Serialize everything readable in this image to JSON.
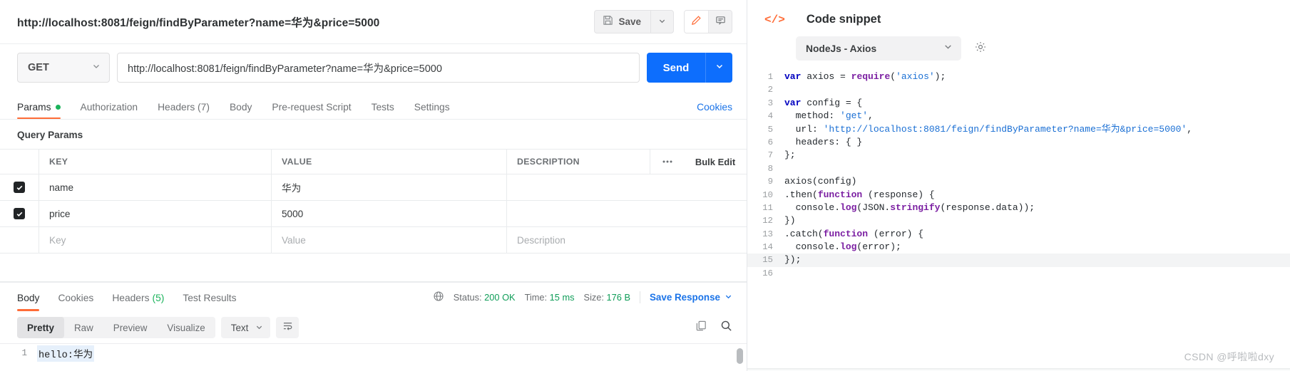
{
  "request": {
    "title": "http://localhost:8081/feign/findByParameter?name=华为&price=5000",
    "save_label": "Save",
    "save_icon": "floppy-disk-icon",
    "save_caret_icon": "chevron-down-icon",
    "edit_icon": "pencil-icon",
    "comment_icon": "comment-icon",
    "method": "GET",
    "method_caret_icon": "chevron-down-icon",
    "url": "http://localhost:8081/feign/findByParameter?name=华为&price=5000",
    "send_label": "Send",
    "send_caret_icon": "chevron-down-icon"
  },
  "request_tabs": [
    {
      "label": "Params",
      "dot": true,
      "active": true
    },
    {
      "label": "Authorization",
      "active": false
    },
    {
      "label": "Headers (7)",
      "active": false
    },
    {
      "label": "Body",
      "active": false
    },
    {
      "label": "Pre-request Script",
      "active": false
    },
    {
      "label": "Tests",
      "active": false
    },
    {
      "label": "Settings",
      "active": false
    }
  ],
  "cookies_link": "Cookies",
  "params": {
    "section_title": "Query Params",
    "columns": {
      "key": "KEY",
      "value": "VALUE",
      "description": "DESCRIPTION"
    },
    "more_icon": "ellipsis-icon",
    "bulk_edit": "Bulk Edit",
    "rows": [
      {
        "checked": true,
        "key": "name",
        "value": "华为",
        "description": ""
      },
      {
        "checked": true,
        "key": "price",
        "value": "5000",
        "description": ""
      }
    ],
    "placeholder_row": {
      "key": "Key",
      "value": "Value",
      "description": "Description"
    }
  },
  "response_tabs": [
    {
      "label": "Body",
      "active": true
    },
    {
      "label": "Cookies",
      "active": false
    },
    {
      "label": "Headers",
      "count": "(5)",
      "active": false
    },
    {
      "label": "Test Results",
      "active": false
    }
  ],
  "response_meta": {
    "globe_icon": "globe-icon",
    "status_label": "Status:",
    "status_value": "200 OK",
    "time_label": "Time:",
    "time_value": "15 ms",
    "size_label": "Size:",
    "size_value": "176 B",
    "save_response": "Save Response",
    "save_response_caret_icon": "chevron-down-icon"
  },
  "viewer": {
    "modes": [
      {
        "label": "Pretty",
        "active": true
      },
      {
        "label": "Raw",
        "active": false
      },
      {
        "label": "Preview",
        "active": false
      },
      {
        "label": "Visualize",
        "active": false
      }
    ],
    "format": "Text",
    "format_caret_icon": "chevron-down-icon",
    "wrap_icon": "wrap-lines-icon",
    "copy_icon": "copy-icon",
    "search_icon": "search-icon",
    "body_line_number": "1",
    "body_text": "hello:华为"
  },
  "code_snippet": {
    "panel_icon": "code-tags-icon",
    "title": "Code snippet",
    "language": "NodeJs - Axios",
    "language_caret_icon": "chevron-down-icon",
    "settings_icon": "gear-icon",
    "lines": [
      {
        "n": "1",
        "tokens": [
          {
            "t": "var ",
            "c": "k-kw"
          },
          {
            "t": "axios = ",
            "c": "k-pl"
          },
          {
            "t": "require",
            "c": "k-fn"
          },
          {
            "t": "(",
            "c": "k-pl"
          },
          {
            "t": "'axios'",
            "c": "k-str"
          },
          {
            "t": ");",
            "c": "k-pl"
          }
        ]
      },
      {
        "n": "2",
        "tokens": []
      },
      {
        "n": "3",
        "tokens": [
          {
            "t": "var ",
            "c": "k-kw"
          },
          {
            "t": "config = {",
            "c": "k-pl"
          }
        ]
      },
      {
        "n": "4",
        "tokens": [
          {
            "t": "  method: ",
            "c": "k-pl"
          },
          {
            "t": "'get'",
            "c": "k-str"
          },
          {
            "t": ",",
            "c": "k-pl"
          }
        ]
      },
      {
        "n": "5",
        "tokens": [
          {
            "t": "  url: ",
            "c": "k-pl"
          },
          {
            "t": "'http://localhost:8081/feign/findByParameter?name=华为&price=5000'",
            "c": "k-str"
          },
          {
            "t": ",",
            "c": "k-pl"
          }
        ]
      },
      {
        "n": "6",
        "tokens": [
          {
            "t": "  headers: { }",
            "c": "k-pl"
          }
        ]
      },
      {
        "n": "7",
        "tokens": [
          {
            "t": "};",
            "c": "k-pl"
          }
        ]
      },
      {
        "n": "8",
        "tokens": []
      },
      {
        "n": "9",
        "tokens": [
          {
            "t": "axios(config)",
            "c": "k-pl"
          }
        ]
      },
      {
        "n": "10",
        "tokens": [
          {
            "t": ".then(",
            "c": "k-pl"
          },
          {
            "t": "function",
            "c": "k-fn"
          },
          {
            "t": " (response) {",
            "c": "k-pl"
          }
        ]
      },
      {
        "n": "11",
        "tokens": [
          {
            "t": "  console.",
            "c": "k-pl"
          },
          {
            "t": "log",
            "c": "k-fn"
          },
          {
            "t": "(JSON.",
            "c": "k-pl"
          },
          {
            "t": "stringify",
            "c": "k-fn"
          },
          {
            "t": "(response.data));",
            "c": "k-pl"
          }
        ]
      },
      {
        "n": "12",
        "tokens": [
          {
            "t": "})",
            "c": "k-pl"
          }
        ]
      },
      {
        "n": "13",
        "tokens": [
          {
            "t": ".catch(",
            "c": "k-pl"
          },
          {
            "t": "function",
            "c": "k-fn"
          },
          {
            "t": " (error) {",
            "c": "k-pl"
          }
        ]
      },
      {
        "n": "14",
        "tokens": [
          {
            "t": "  console.",
            "c": "k-pl"
          },
          {
            "t": "log",
            "c": "k-fn"
          },
          {
            "t": "(error);",
            "c": "k-pl"
          }
        ]
      },
      {
        "n": "15",
        "tokens": [
          {
            "t": "});",
            "c": "k-pl"
          }
        ],
        "highlight": true
      },
      {
        "n": "16",
        "tokens": []
      }
    ]
  },
  "watermark": "CSDN @呼啦啦dxy",
  "colors": {
    "accent_orange": "#ff6c37",
    "primary_blue": "#0d6efd",
    "link_blue": "#1a73e8",
    "success_green": "#0f9d58"
  }
}
